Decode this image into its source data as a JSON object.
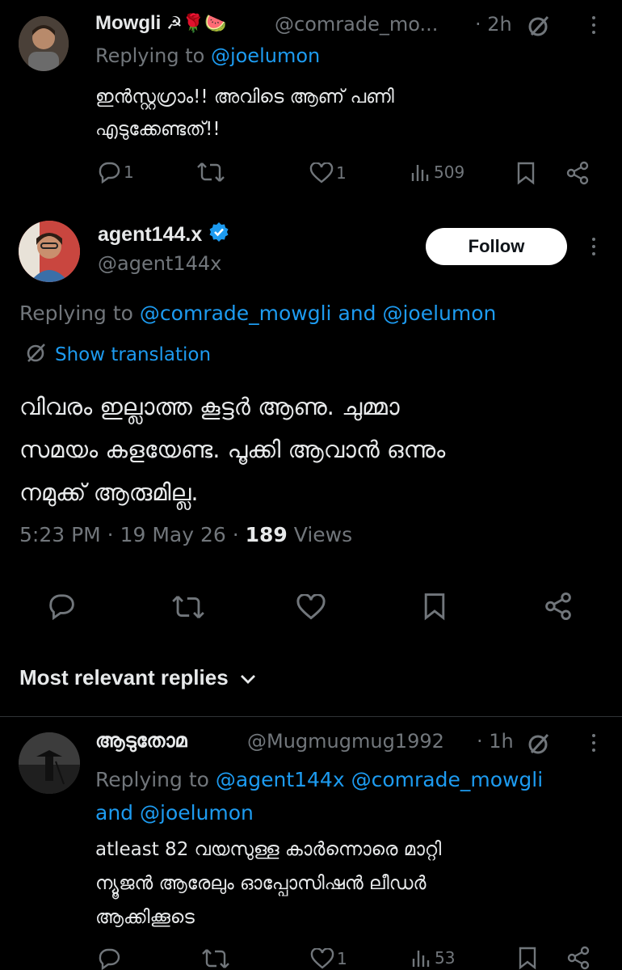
{
  "tweet1": {
    "name": "Mowgli",
    "name_emoji": "☭🌹🍉",
    "handle": "@comrade_mo...",
    "time": "· 2h",
    "replying_prefix": "Replying to",
    "replying_to": "@joelumon",
    "body_line1": "ഇൻസ്റ്റഗ്രാം!! അവിടെ ആണ് പണി",
    "body_line2": "എടുക്കേണ്ടത്!!",
    "replies": "1",
    "likes": "1",
    "views": "509"
  },
  "main_tweet": {
    "name": "agent144.x",
    "handle": "@agent144x",
    "follow_label": "Follow",
    "replying_prefix": "Replying to",
    "replying_to_1": "@comrade_mowgli",
    "replying_and": "and",
    "replying_to_2": "@joelumon",
    "show_translation": "Show translation",
    "body_line1": "വിവരം ഇല്ലാത്ത കൂട്ടർ ആണു. ചുമ്മാ",
    "body_line2": "സമയം കളയേണ്ട. പൂക്കി ആവാൻ ഒന്നും",
    "body_line3": "നമുക്ക് ആരുമില്ല.",
    "meta_time": "5:23 PM · 19 May 26 ·",
    "meta_views_count": "189",
    "meta_views_label": "Views"
  },
  "replies_header": "Most relevant replies",
  "tweet3": {
    "name": "ആടുതോമ",
    "handle": "@Mugmugmug1992",
    "time": "· 1h",
    "replying_prefix": "Replying to",
    "replying_to_1": "@agent144x",
    "replying_to_2": "@comrade_mowgli",
    "replying_and": "and",
    "replying_to_3": "@joelumon",
    "body_line1": "atleast 82 വയസുള്ള കാർന്നൊരെ മാറ്റി",
    "body_line2": "ന്യൂജൻ ആരേലും ഓപ്പോസിഷൻ ലീഡർ",
    "body_line3": "ആക്കിക്കൂടെ",
    "likes": "1",
    "views": "53"
  },
  "colors": {
    "accent": "#1d9bf0",
    "muted": "#71767b",
    "text": "#e7e9ea",
    "bg": "#000000"
  }
}
